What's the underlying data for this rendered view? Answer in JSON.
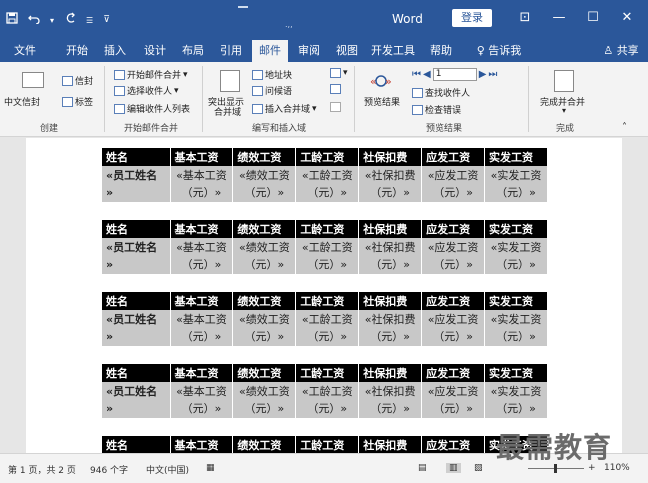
{
  "titlebar": {
    "save_icon": "save-icon",
    "undo_icon": "undo-icon",
    "redo_icon": "redo-icon",
    "app_name": "Word",
    "login_label": "登录",
    "ribbon_display_icon": "ribbon-display-icon",
    "minimize_icon": "minimize-icon",
    "maximize_icon": "maximize-icon",
    "close_icon": "close-icon"
  },
  "tabs": [
    {
      "label": "文件"
    },
    {
      "label": "开始"
    },
    {
      "label": "插入"
    },
    {
      "label": "设计"
    },
    {
      "label": "布局"
    },
    {
      "label": "引用"
    },
    {
      "label": "邮件"
    },
    {
      "label": "审阅"
    },
    {
      "label": "视图"
    },
    {
      "label": "开发工具"
    },
    {
      "label": "帮助"
    },
    {
      "label": "告诉我"
    },
    {
      "label": "共享"
    }
  ],
  "ribbon": {
    "create": {
      "envelope_label": "信封",
      "chinese_envelope_label": "中文信封",
      "labels_label": "标签",
      "group_label": "创建"
    },
    "start_merge": {
      "start_label": "开始邮件合并",
      "select_recipients_label": "选择收件人",
      "edit_recipients_label": "编辑收件人列表",
      "group_label": "开始邮件合并"
    },
    "write_insert": {
      "highlight_label_1": "突出显示",
      "highlight_label_2": "合并域",
      "address_block_label": "地址块",
      "greeting_label": "问候语",
      "insert_field_label": "插入合并域",
      "group_label": "编写和插入域"
    },
    "preview": {
      "preview_label": "预览结果",
      "record_value": "1",
      "find_recipient_label": "查找收件人",
      "check_errors_label": "检查错误",
      "group_label": "预览结果"
    },
    "finish": {
      "finish_label": "完成并合并",
      "group_label": "完成"
    }
  },
  "table": {
    "headers": [
      "姓名",
      "基本工资",
      "绩效工资",
      "工龄工资",
      "社保扣费",
      "应发工资",
      "实发工资"
    ],
    "row": [
      {
        "line1": "«员工姓名",
        "line2": "»"
      },
      {
        "line1": "«基本工资",
        "line2": "（元）»"
      },
      {
        "line1": "«绩效工资",
        "line2": "（元）»"
      },
      {
        "line1": "«工龄工资",
        "line2": "（元）»"
      },
      {
        "line1": "«社保扣费",
        "line2": "（元）»"
      },
      {
        "line1": "«应发工资",
        "line2": "（元）»"
      },
      {
        "line1": "«实发工资",
        "line2": "（元）»"
      }
    ]
  },
  "statusbar": {
    "page_info": "第 1 页，共 2 页",
    "word_count": "946 个字",
    "language": "中文(中国)",
    "zoom": "110%"
  },
  "watermark": "最需教育"
}
